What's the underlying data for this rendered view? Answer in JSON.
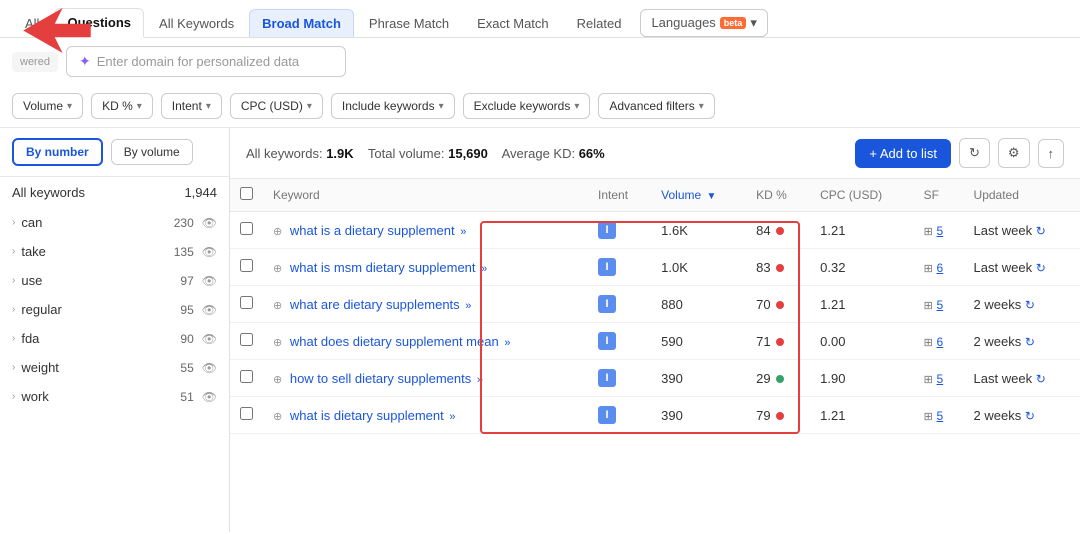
{
  "tabs": [
    {
      "id": "all",
      "label": "All",
      "state": "normal"
    },
    {
      "id": "questions",
      "label": "Questions",
      "state": "active"
    },
    {
      "id": "all-keywords",
      "label": "All Keywords",
      "state": "normal"
    },
    {
      "id": "broad-match",
      "label": "Broad Match",
      "state": "highlighted"
    },
    {
      "id": "phrase-match",
      "label": "Phrase Match",
      "state": "normal"
    },
    {
      "id": "exact-match",
      "label": "Exact Match",
      "state": "normal"
    },
    {
      "id": "related",
      "label": "Related",
      "state": "normal"
    }
  ],
  "languages_tab": {
    "label": "Languages",
    "beta": "beta"
  },
  "domain_input": {
    "placeholder": "Enter domain for personalized data",
    "powered": "wered"
  },
  "filters": [
    {
      "id": "volume",
      "label": "Volume"
    },
    {
      "id": "kd",
      "label": "KD %"
    },
    {
      "id": "intent",
      "label": "Intent"
    },
    {
      "id": "cpc",
      "label": "CPC (USD)"
    },
    {
      "id": "include",
      "label": "Include keywords"
    },
    {
      "id": "exclude",
      "label": "Exclude keywords"
    },
    {
      "id": "advanced",
      "label": "Advanced filters"
    }
  ],
  "sidebar": {
    "toggle_by_number": "By number",
    "toggle_by_volume": "By volume",
    "all_keywords_label": "All keywords",
    "all_keywords_count": "1,944",
    "items": [
      {
        "keyword": "can",
        "count": "230"
      },
      {
        "keyword": "take",
        "count": "135"
      },
      {
        "keyword": "use",
        "count": "97"
      },
      {
        "keyword": "regular",
        "count": "95"
      },
      {
        "keyword": "fda",
        "count": "90"
      },
      {
        "keyword": "weight",
        "count": "55"
      },
      {
        "keyword": "work",
        "count": "51"
      }
    ]
  },
  "table_header_bar": {
    "label_all": "All keywords:",
    "count": "1.9K",
    "label_volume": "Total volume:",
    "volume": "15,690",
    "label_avg": "Average KD:",
    "avg_kd": "66%",
    "add_btn": "+ Add to list"
  },
  "table": {
    "columns": [
      {
        "id": "keyword",
        "label": "Keyword"
      },
      {
        "id": "intent",
        "label": "Intent"
      },
      {
        "id": "volume",
        "label": "Volume",
        "sorted": true
      },
      {
        "id": "kd",
        "label": "KD %"
      },
      {
        "id": "cpc",
        "label": "CPC (USD)"
      },
      {
        "id": "sf",
        "label": "SF"
      },
      {
        "id": "updated",
        "label": "Updated"
      }
    ],
    "rows": [
      {
        "keyword": "what is a dietary supplement",
        "intent": "I",
        "volume": "1.6K",
        "kd": "84",
        "kd_color": "red",
        "cpc": "1.21",
        "sf": "5",
        "updated": "Last week"
      },
      {
        "keyword": "what is msm dietary supplement",
        "intent": "I",
        "volume": "1.0K",
        "kd": "83",
        "kd_color": "red",
        "cpc": "0.32",
        "sf": "6",
        "updated": "Last week"
      },
      {
        "keyword": "what are dietary supplements",
        "intent": "I",
        "volume": "880",
        "kd": "70",
        "kd_color": "red",
        "cpc": "1.21",
        "sf": "5",
        "updated": "2 weeks"
      },
      {
        "keyword": "what does dietary supplement mean",
        "intent": "I",
        "volume": "590",
        "kd": "71",
        "kd_color": "red",
        "cpc": "0.00",
        "sf": "6",
        "updated": "2 weeks"
      },
      {
        "keyword": "how to sell dietary supplements",
        "intent": "I",
        "volume": "390",
        "kd": "29",
        "kd_color": "green",
        "cpc": "1.90",
        "sf": "5",
        "updated": "Last week"
      },
      {
        "keyword": "what is dietary supplement",
        "intent": "I",
        "volume": "390",
        "kd": "79",
        "kd_color": "red",
        "cpc": "1.21",
        "sf": "5",
        "updated": "2 weeks"
      }
    ]
  }
}
